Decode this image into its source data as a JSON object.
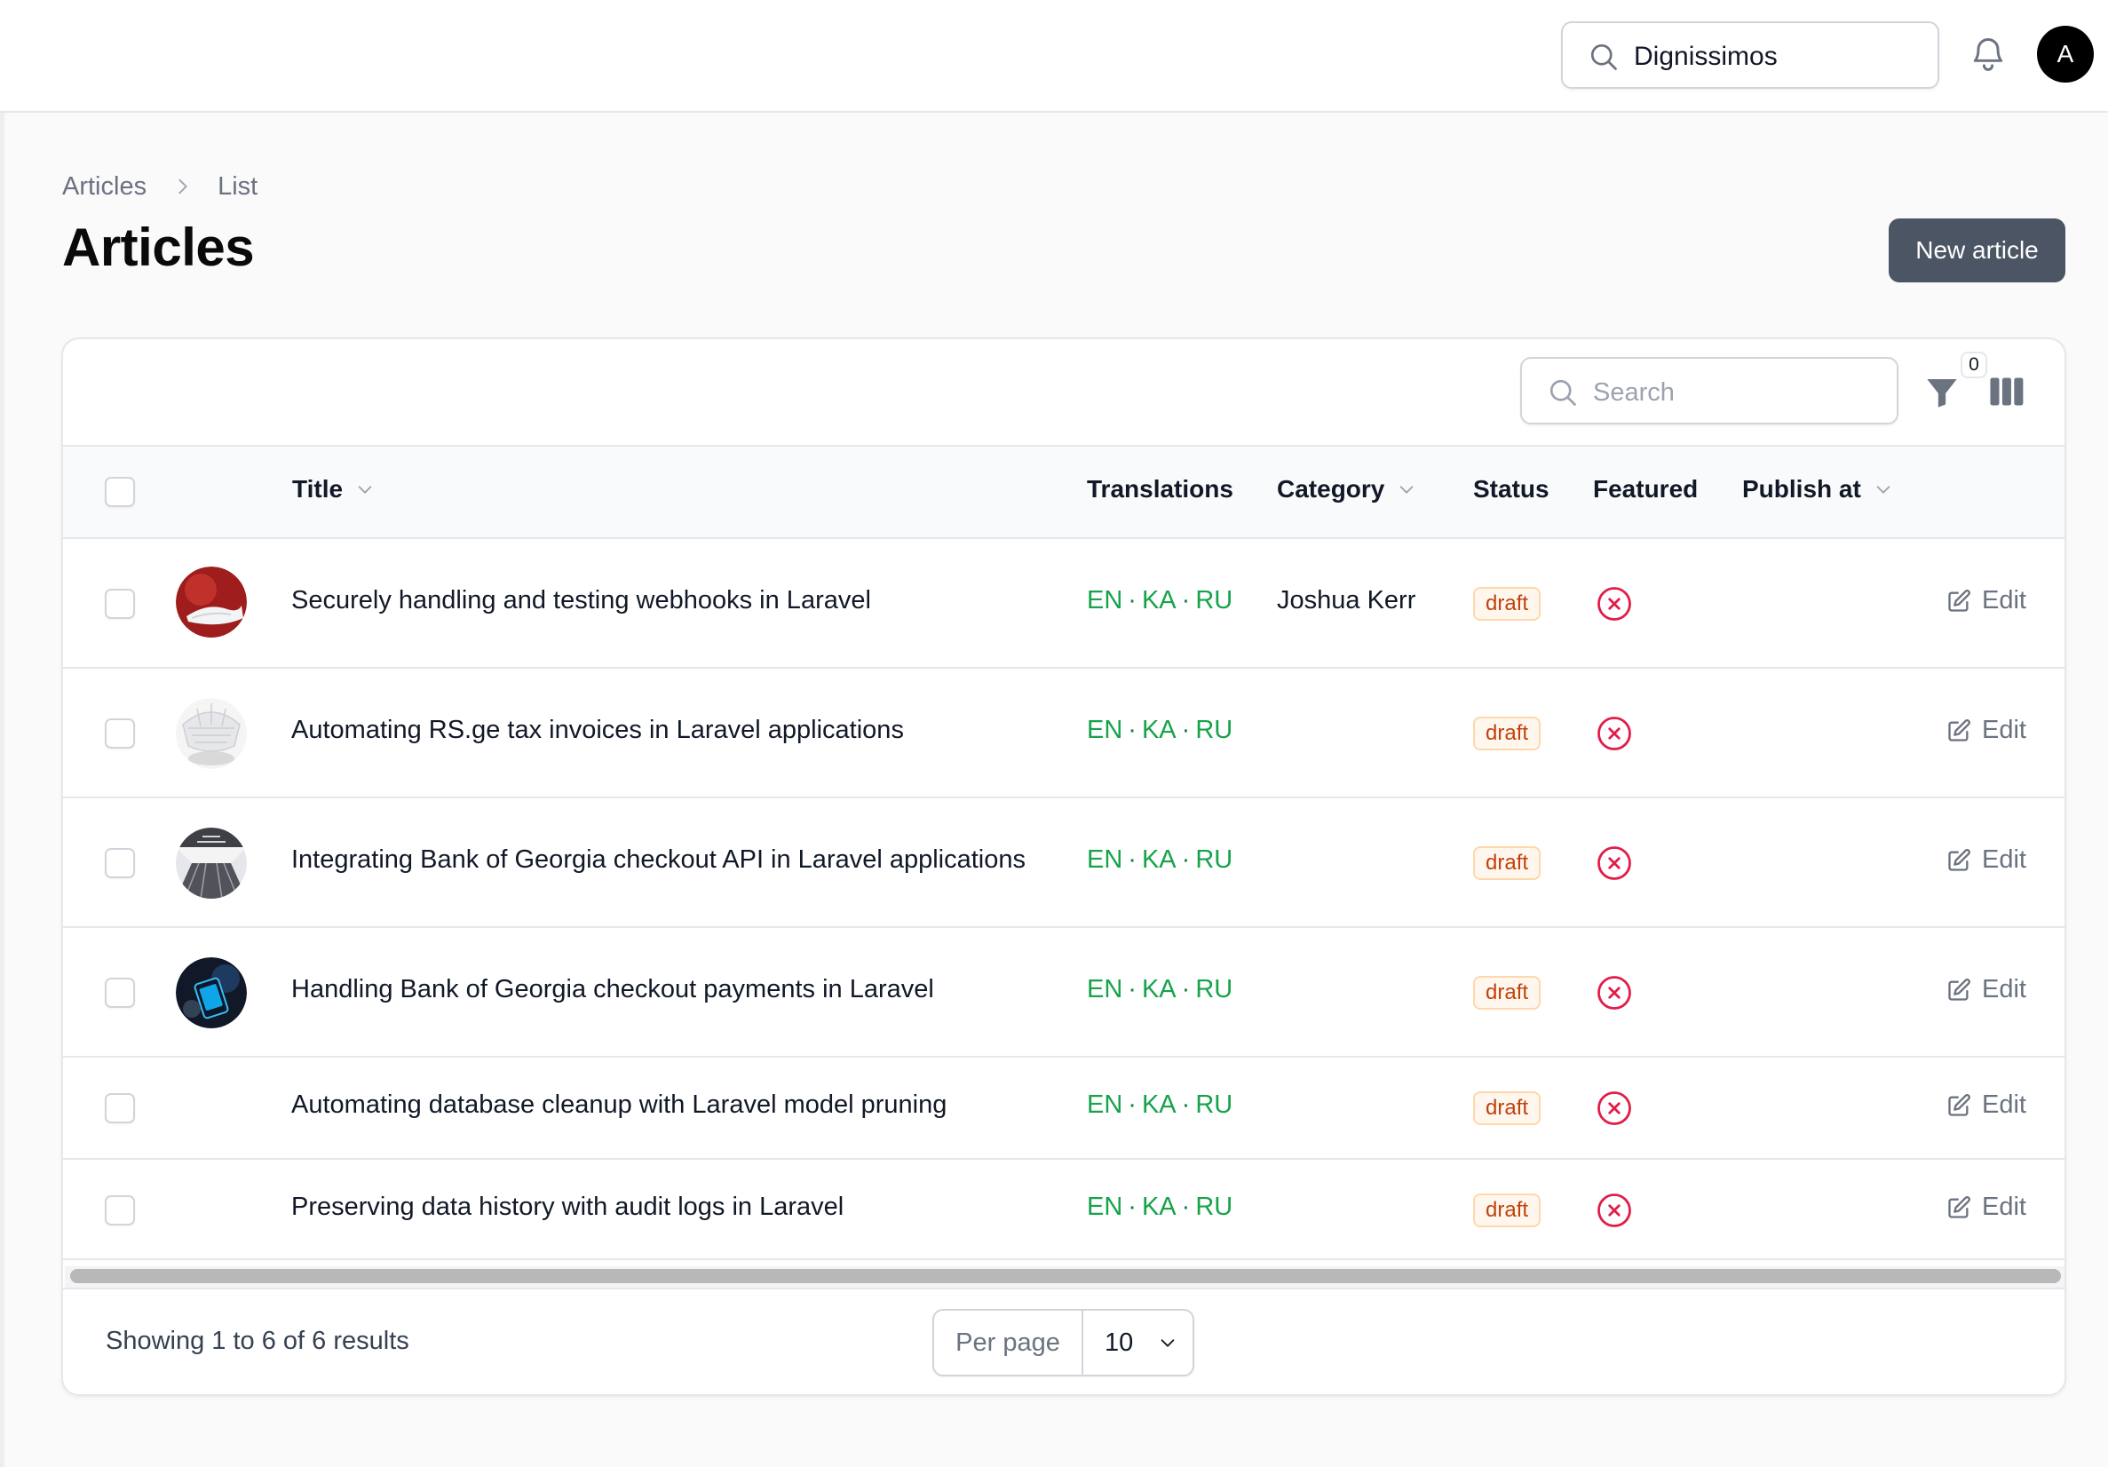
{
  "topbar": {
    "search_value": "Dignissimos",
    "avatar_initial": "A"
  },
  "breadcrumb": {
    "items": [
      "Articles",
      "List"
    ]
  },
  "page": {
    "title": "Articles",
    "new_button": "New article"
  },
  "table": {
    "search_placeholder": "Search",
    "filter_count": "0",
    "columns": {
      "title": "Title",
      "translations": "Translations",
      "category": "Category",
      "status": "Status",
      "featured": "Featured",
      "publish_at": "Publish at"
    },
    "rows": [
      {
        "title": "Securely handling and testing webhooks in Laravel",
        "translations": [
          "EN",
          "KA",
          "RU"
        ],
        "category": "Joshua Kerr",
        "status": "draft",
        "featured": false,
        "thumbnail": "red-shoe-photo",
        "edit": "Edit"
      },
      {
        "title": "Automating RS.ge tax invoices in Laravel applications",
        "translations": [
          "EN",
          "KA",
          "RU"
        ],
        "category": "",
        "status": "draft",
        "featured": false,
        "thumbnail": "white-architecture-photo",
        "edit": "Edit"
      },
      {
        "title": "Integrating Bank of Georgia checkout API in Laravel applications",
        "translations": [
          "EN",
          "KA",
          "RU"
        ],
        "category": "",
        "status": "draft",
        "featured": false,
        "thumbnail": "building-ceiling-photo",
        "edit": "Edit"
      },
      {
        "title": "Handling Bank of Georgia checkout payments in Laravel",
        "translations": [
          "EN",
          "KA",
          "RU"
        ],
        "category": "",
        "status": "draft",
        "featured": false,
        "thumbnail": "phone-screen-photo",
        "edit": "Edit"
      },
      {
        "title": "Automating database cleanup with Laravel model pruning",
        "translations": [
          "EN",
          "KA",
          "RU"
        ],
        "category": "",
        "status": "draft",
        "featured": false,
        "thumbnail": "",
        "edit": "Edit"
      },
      {
        "title": "Preserving data history with audit logs in Laravel",
        "translations": [
          "EN",
          "KA",
          "RU"
        ],
        "category": "",
        "status": "draft",
        "featured": false,
        "thumbnail": "",
        "edit": "Edit"
      }
    ],
    "footer": {
      "results_text": "Showing 1 to 6 of 6 results",
      "per_page_label": "Per page",
      "per_page_value": "10"
    }
  },
  "colors": {
    "primary_button": "#4b5563",
    "translation_text": "#16a34a",
    "draft_badge_text": "#c2410c",
    "draft_badge_bg": "#fff7ed",
    "featured_false": "#e11d48"
  }
}
